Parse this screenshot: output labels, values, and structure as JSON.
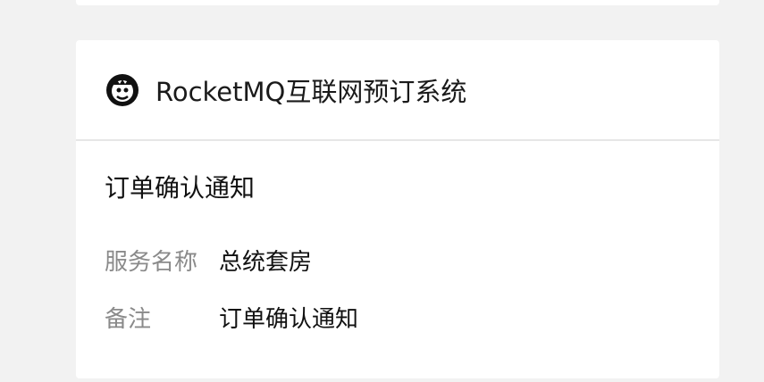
{
  "header": {
    "logo_icon": "rocketmq-logo-icon",
    "app_title": "RocketMQ互联网预订系统"
  },
  "notice": {
    "title": "订单确认通知",
    "rows": [
      {
        "label": "服务名称",
        "value": "总统套房"
      },
      {
        "label": "备注",
        "value": "订单确认通知"
      }
    ]
  },
  "colors": {
    "background": "#f2f2f2",
    "card": "#ffffff",
    "divider": "#e6e6e6",
    "label": "#8a8a8a",
    "text": "#111111"
  }
}
